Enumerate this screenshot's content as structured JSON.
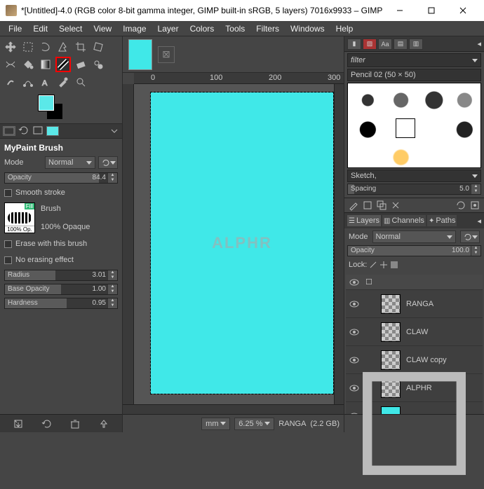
{
  "window": {
    "title": "*[Untitled]-4.0 (RGB color 8-bit gamma integer, GIMP built-in sRGB, 5 layers) 7016x9933 – GIMP"
  },
  "menu": [
    "File",
    "Edit",
    "Select",
    "View",
    "Image",
    "Layer",
    "Colors",
    "Tools",
    "Filters",
    "Windows",
    "Help"
  ],
  "tool_options": {
    "title": "MyPaint Brush",
    "mode_label": "Mode",
    "mode_value": "Normal",
    "opacity_label": "Opacity",
    "opacity_value": "84.4",
    "smooth_stroke": "Smooth stroke",
    "brush_label": "Brush",
    "brush_caption": "100% Op.",
    "brush_fill": "Fill",
    "brush_desc": "100% Opaque",
    "erase_with": "Erase with this brush",
    "no_erasing": "No erasing effect",
    "radius_label": "Radius",
    "radius_value": "3.01",
    "base_opacity_label": "Base Opacity",
    "base_opacity_value": "1.00",
    "hardness_label": "Hardness",
    "hardness_value": "0.95"
  },
  "canvas": {
    "ruler_marks": [
      "0",
      "100",
      "200",
      "300"
    ],
    "watermark": "ALPHR"
  },
  "status": {
    "unit": "mm",
    "zoom": "6.25 %",
    "layer": "RANGA",
    "mem": "(2.2 GB)"
  },
  "brushes": {
    "filter_placeholder": "filter",
    "name": "Pencil 02 (50 × 50)",
    "preset": "Sketch,",
    "spacing_label": "Spacing",
    "spacing_value": "5.0"
  },
  "layers_panel": {
    "tabs": [
      "Layers",
      "Channels",
      "Paths"
    ],
    "mode_label": "Mode",
    "mode_value": "Normal",
    "opacity_label": "Opacity",
    "opacity_value": "100.0",
    "lock_label": "Lock:",
    "layers": [
      {
        "name": "RANGA",
        "thumb": "checker"
      },
      {
        "name": "CLAW",
        "thumb": "checker"
      },
      {
        "name": "CLAW copy",
        "thumb": "checker"
      },
      {
        "name": "ALPHR",
        "thumb": "checker"
      },
      {
        "name": "",
        "thumb": "cyan"
      }
    ]
  }
}
